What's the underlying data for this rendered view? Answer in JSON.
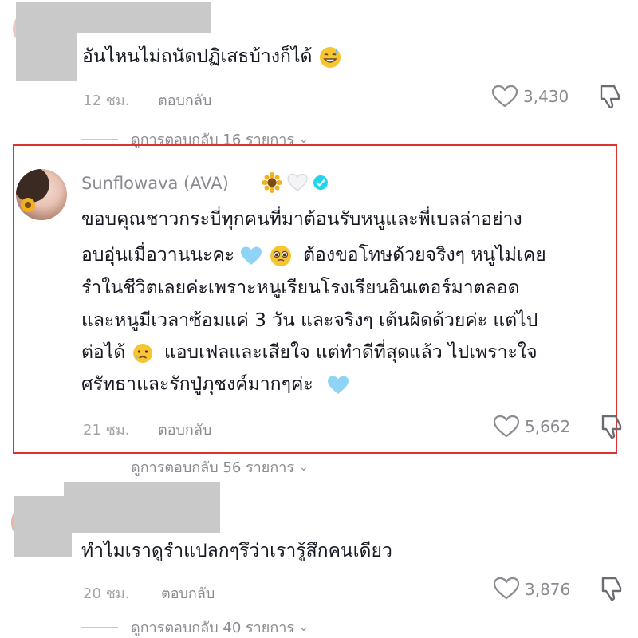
{
  "comment1": {
    "text": "อันไหนไม่ถนัดปฏิเสธบ้างก็ได้",
    "emoji": "sweat-smile-emoji",
    "time": "12 ชม.",
    "reply": "ตอบกลับ",
    "likes": "3,430",
    "view_replies": "ดูการตอบกลับ 16 รายการ"
  },
  "comment2": {
    "username": "Sunflowava (AVA)",
    "lines": [
      "ขอบคุณชาวกระบี่ทุกคนที่มาต้อนรับหนูและพี่เบลล่าอย่าง",
      "อบอุ่นเมื่อวานนะคะ",
      "ต้องขอโทษด้วยจริงๆ หนูไม่เคย",
      "รำในชีวิตเลยค่ะเพราะหนูเรียนโรงเรียนอินเตอร์มาตลอด",
      "และหนูมีเวลาซ้อมแค่ 3 วัน และจริงๆ เต้นผิดด้วยค่ะ แต่ไป",
      "ต่อได้",
      "แอบเฟลและเสียใจ แต่ทำดีที่สุดแล้ว ไปเพราะใจ",
      "ศรัทธาและรักปู่ภุชงค์มากๆค่ะ"
    ],
    "time": "21 ชม.",
    "reply": "ตอบกลับ",
    "likes": "5,662",
    "view_replies": "ดูการตอบกลับ 56 รายการ"
  },
  "comment3": {
    "text": "ทำไมเราดูรำแปลกๆรึว่าเรารู้สึกคนเดียว",
    "time": "20 ชม.",
    "reply": "ตอบกลับ",
    "likes": "3,876",
    "view_replies": "ดูการตอบกลับ 40 รายการ"
  },
  "colors": {
    "highlight": "#e03131",
    "text": "#161823",
    "muted": "#8a8b91",
    "verified": "#20d5ec"
  }
}
